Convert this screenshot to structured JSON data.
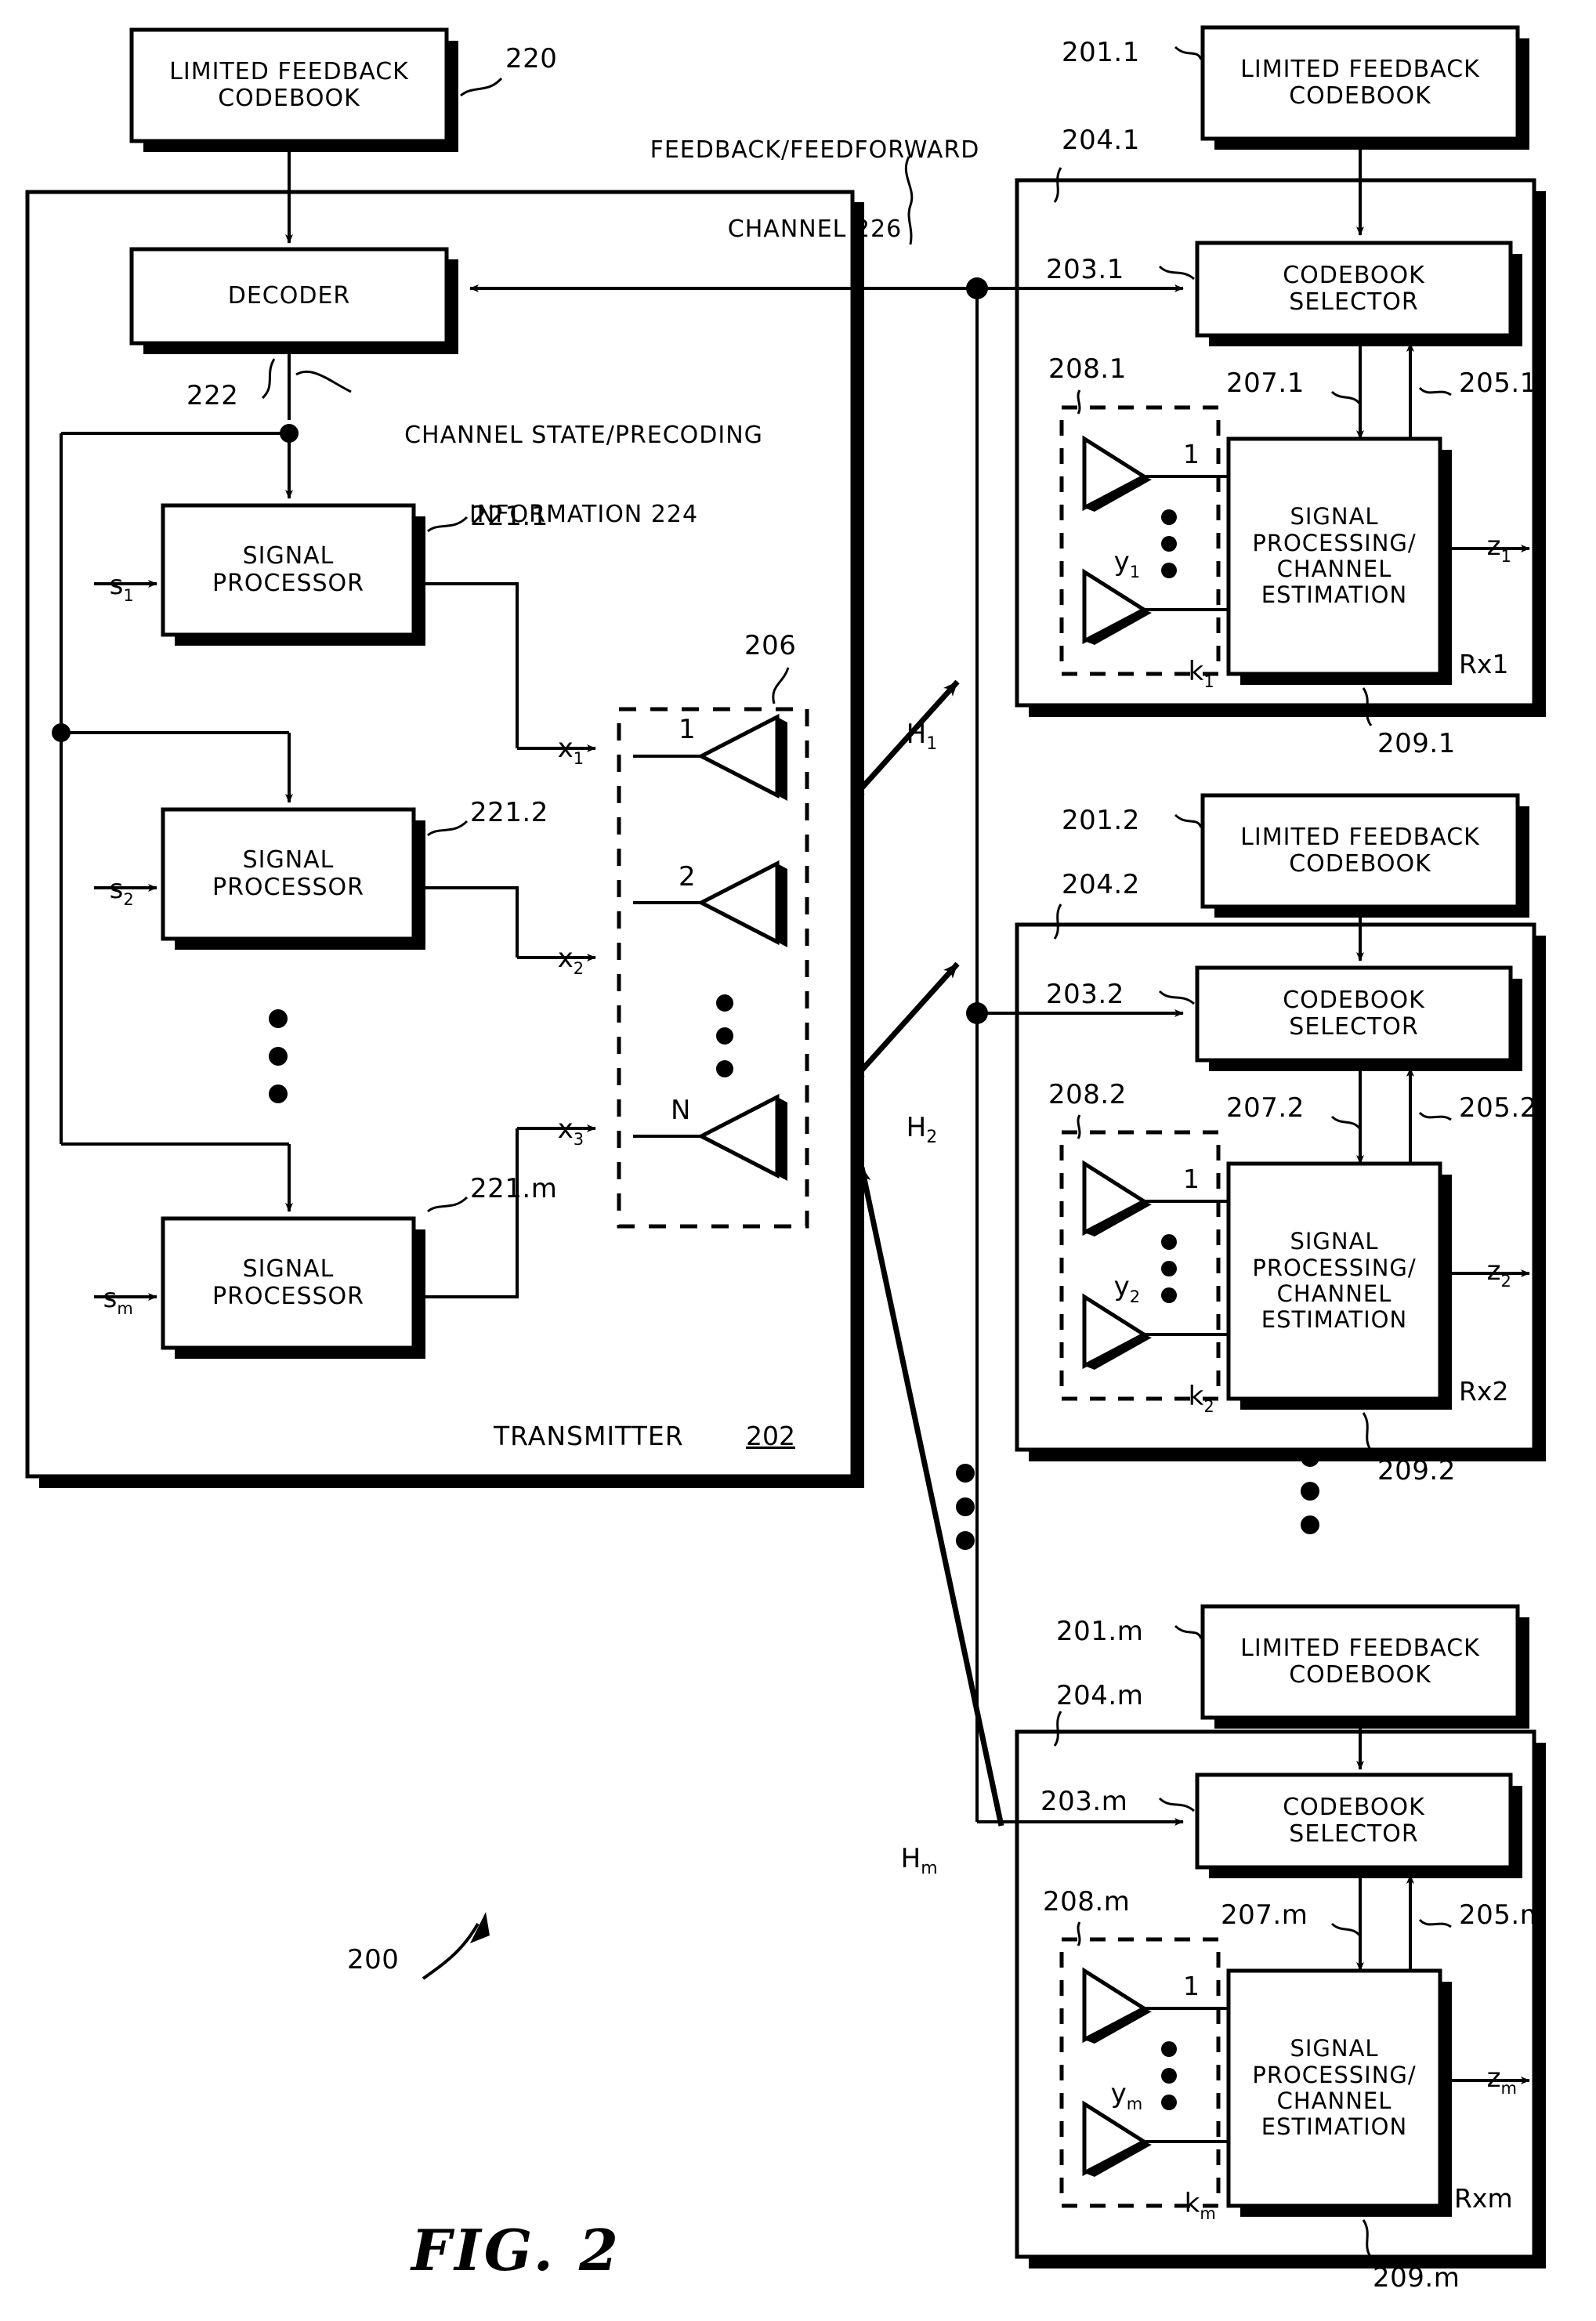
{
  "figure": {
    "caption": "FIG. 2",
    "system_ref": "200"
  },
  "transmitter": {
    "label": "TRANSMITTER",
    "ref": "202",
    "codebook": {
      "line1": "LIMITED FEEDBACK",
      "line2": "CODEBOOK",
      "ref": "220"
    },
    "decoder": {
      "label": "DECODER",
      "ref": "222"
    },
    "channel_info": {
      "line1": "CHANNEL STATE/PRECODING",
      "line2": "INFORMATION 224"
    },
    "signal_processors": [
      {
        "line1": "SIGNAL",
        "line2": "PROCESSOR",
        "ref": "221.1",
        "input": "s",
        "input_sub": "1",
        "output": "x",
        "output_sub": "1"
      },
      {
        "line1": "SIGNAL",
        "line2": "PROCESSOR",
        "ref": "221.2",
        "input": "s",
        "input_sub": "2",
        "output": "x",
        "output_sub": "2"
      },
      {
        "line1": "SIGNAL",
        "line2": "PROCESSOR",
        "ref": "221.m",
        "input": "s",
        "input_sub": "m",
        "output": "x",
        "output_sub": "3"
      }
    ],
    "antenna_array": {
      "ref": "206",
      "elements": [
        "1",
        "2",
        "N"
      ]
    }
  },
  "channel": {
    "title_line1": "FEEDBACK/FEEDFORWARD",
    "title_line2": "CHANNEL 226",
    "links": [
      {
        "name": "H",
        "sub": "1"
      },
      {
        "name": "H",
        "sub": "2"
      },
      {
        "name": "H",
        "sub": "m"
      }
    ]
  },
  "receivers": [
    {
      "name": "Rx1",
      "codebook": {
        "line1": "LIMITED FEEDBACK",
        "line2": "CODEBOOK",
        "ref": "201.1"
      },
      "enclosure_ref": "204.1",
      "selector": {
        "line1": "CODEBOOK",
        "line2": "SELECTOR",
        "ref": "203.1"
      },
      "antenna_ref": "208.1",
      "antenna_top": "1",
      "antenna_bottom": "k",
      "antenna_bottom_sub": "1",
      "antenna_signal": "y",
      "antenna_signal_sub": "1",
      "processor": {
        "line1": "SIGNAL",
        "line2": "PROCESSING/",
        "line3": "CHANNEL",
        "line4": "ESTIMATION",
        "ref": "209.1"
      },
      "feed_ref": "207.1",
      "return_ref": "205.1",
      "output": "z",
      "output_sub": "1"
    },
    {
      "name": "Rx2",
      "codebook": {
        "line1": "LIMITED FEEDBACK",
        "line2": "CODEBOOK",
        "ref": "201.2"
      },
      "enclosure_ref": "204.2",
      "selector": {
        "line1": "CODEBOOK",
        "line2": "SELECTOR",
        "ref": "203.2"
      },
      "antenna_ref": "208.2",
      "antenna_top": "1",
      "antenna_bottom": "k",
      "antenna_bottom_sub": "2",
      "antenna_signal": "y",
      "antenna_signal_sub": "2",
      "processor": {
        "line1": "SIGNAL",
        "line2": "PROCESSING/",
        "line3": "CHANNEL",
        "line4": "ESTIMATION",
        "ref": "209.2"
      },
      "feed_ref": "207.2",
      "return_ref": "205.2",
      "output": "z",
      "output_sub": "2"
    },
    {
      "name": "Rxm",
      "codebook": {
        "line1": "LIMITED FEEDBACK",
        "line2": "CODEBOOK",
        "ref": "201.m"
      },
      "enclosure_ref": "204.m",
      "selector": {
        "line1": "CODEBOOK",
        "line2": "SELECTOR",
        "ref": "203.m"
      },
      "antenna_ref": "208.m",
      "antenna_top": "1",
      "antenna_bottom": "k",
      "antenna_bottom_sub": "m",
      "antenna_signal": "y",
      "antenna_signal_sub": "m",
      "processor": {
        "line1": "SIGNAL",
        "line2": "PROCESSING/",
        "line3": "CHANNEL",
        "line4": "ESTIMATION",
        "ref": "209.m"
      },
      "feed_ref": "207.m",
      "return_ref": "205.m",
      "output": "z",
      "output_sub": "m"
    }
  ]
}
